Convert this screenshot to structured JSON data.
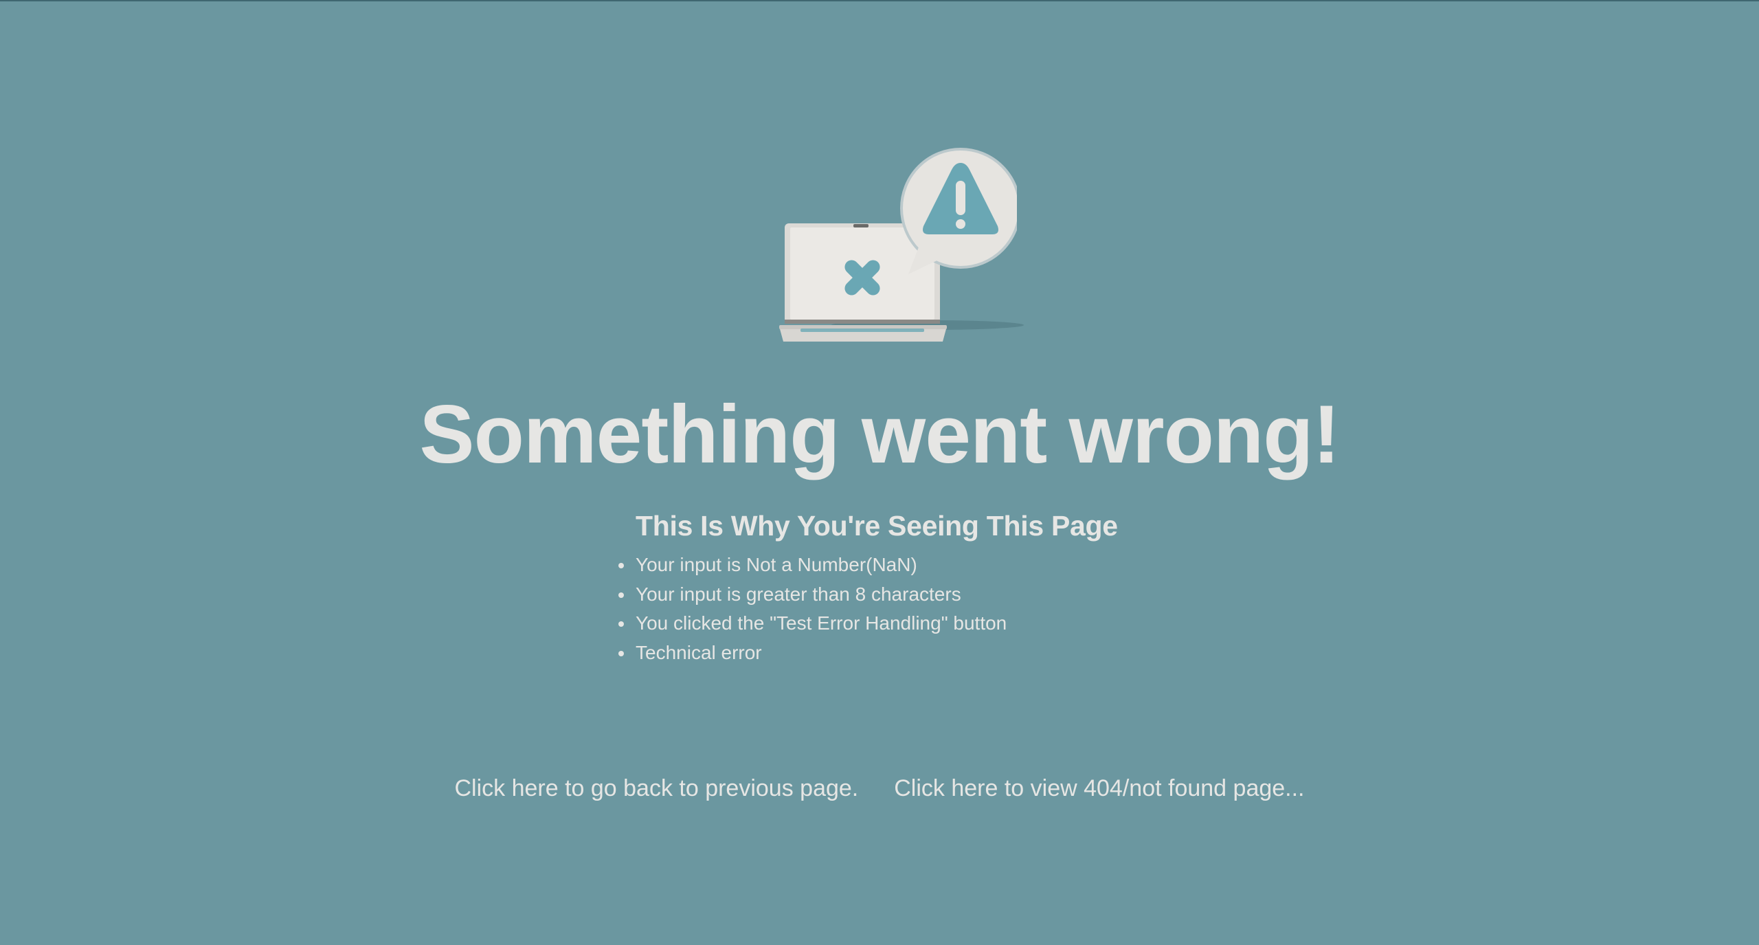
{
  "illustration": {
    "laptop_icon": "laptop-with-x-icon",
    "alert_icon": "warning-triangle-speech-bubble-icon"
  },
  "headline": "Something went wrong!",
  "reasons": {
    "title": "This Is Why You're Seeing This Page",
    "items": [
      "Your input is Not a Number(NaN)",
      "Your input is greater than 8 characters",
      "You clicked the \"Test Error Handling\" button",
      "Technical error"
    ]
  },
  "links": {
    "back": "Click here to go back to previous page.",
    "not_found": "Click here to view 404/not found page..."
  },
  "colors": {
    "background": "#6b97a0",
    "text": "#e6e6e4",
    "accent": "#6aa7b4"
  }
}
